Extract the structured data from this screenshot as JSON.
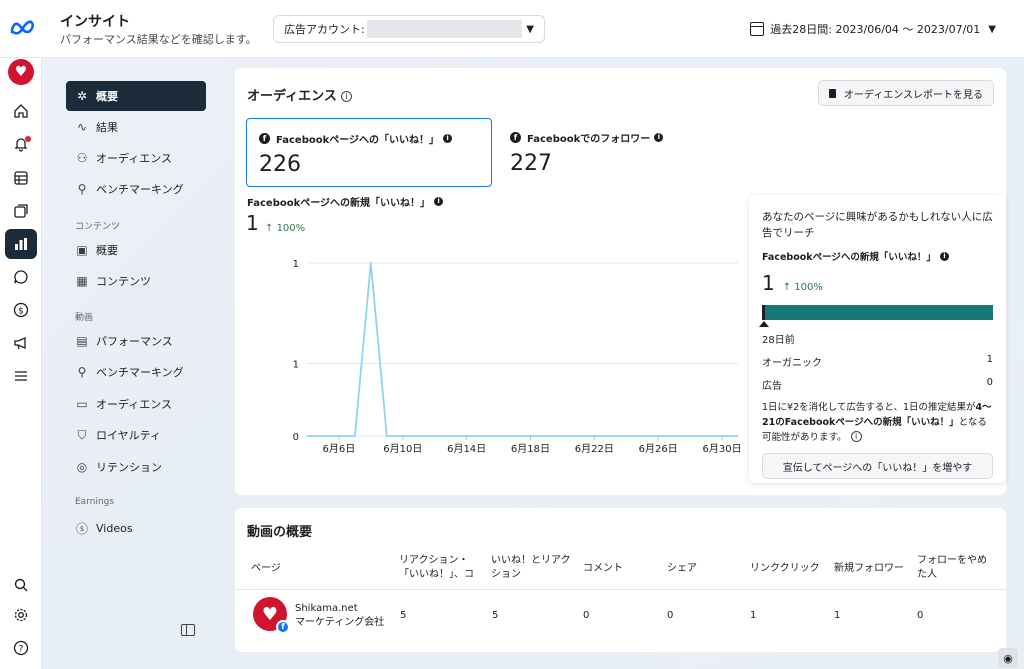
{
  "header": {
    "title": "インサイト",
    "subtitle": "パフォーマンス結果などを確認します。",
    "ad_account_label": "広告アカウント:",
    "date_range": "過去28日間: 2023/06/04 〜 2023/07/01"
  },
  "sidebar": {
    "items": [
      {
        "label": "概要",
        "icon": "overview-icon"
      },
      {
        "label": "結果",
        "icon": "results-icon"
      },
      {
        "label": "オーディエンス",
        "icon": "audience-icon"
      },
      {
        "label": "ベンチマーキング",
        "icon": "benchmark-icon"
      }
    ],
    "content_section": "コンテンツ",
    "content_items": [
      {
        "label": "概要",
        "icon": "content-overview-icon"
      },
      {
        "label": "コンテンツ",
        "icon": "content-table-icon"
      }
    ],
    "video_section": "動画",
    "video_items": [
      {
        "label": "パフォーマンス",
        "icon": "performance-icon"
      },
      {
        "label": "ベンチマーキング",
        "icon": "benchmark-icon"
      },
      {
        "label": "オーディエンス",
        "icon": "video-audience-icon"
      },
      {
        "label": "ロイヤルティ",
        "icon": "loyalty-icon"
      },
      {
        "label": "リテンション",
        "icon": "retention-icon"
      }
    ],
    "earnings_section": "Earnings",
    "earnings_items": [
      {
        "label": "Videos",
        "icon": "dollar-icon"
      }
    ]
  },
  "audience": {
    "title": "オーディエンス",
    "report_button": "オーディエンスレポートを見る",
    "metrics": [
      {
        "label": "Facebookページへの「いいね！」",
        "value": "226"
      },
      {
        "label": "Facebookでのフォロワー",
        "value": "227"
      }
    ],
    "chart_title": "Facebookページへの新規「いいね！」",
    "chart_value": "1",
    "chart_delta": "100%"
  },
  "chart_data": {
    "type": "line",
    "title": "Facebookページへの新規「いいね！」",
    "x": [
      "6/4",
      "6/5",
      "6/6",
      "6/7",
      "6/8",
      "6/9",
      "6/10",
      "6/11",
      "6/12",
      "6/13",
      "6/14",
      "6/15",
      "6/16",
      "6/17",
      "6/18",
      "6/19",
      "6/20",
      "6/21",
      "6/22",
      "6/23",
      "6/24",
      "6/25",
      "6/26",
      "6/27",
      "6/28",
      "6/29",
      "6/30",
      "7/1"
    ],
    "values": [
      0,
      0,
      0,
      0,
      1,
      0,
      0,
      0,
      0,
      0,
      0,
      0,
      0,
      0,
      0,
      0,
      0,
      0,
      0,
      0,
      0,
      0,
      0,
      0,
      0,
      0,
      0,
      0
    ],
    "xtick_labels": [
      "6月6日",
      "6月10日",
      "6月14日",
      "6月18日",
      "6月22日",
      "6月26日",
      "6月30日"
    ],
    "ytick_labels": [
      "1",
      "1",
      "0"
    ],
    "ylim": [
      0,
      1
    ],
    "color": "#8fd3ef",
    "grid": true
  },
  "reach": {
    "heading": "あなたのページに興味があるかもしれない人に広告でリーチ",
    "metric_label": "Facebookページへの新規「いいね！」",
    "value": "1",
    "delta": "100%",
    "days_ago": "28日前",
    "organic_label": "オーガニック",
    "organic_value": "1",
    "ad_label": "広告",
    "ad_value": "0",
    "note_a": "1日に¥2を消化して広告すると、1日の推定結果が",
    "note_b": "4〜21のFacebookページへの新規「いいね！」",
    "note_c": "となる可能性があります。",
    "button": "宣伝してページへの「いいね！」を増やす",
    "bar_color": "#157a74"
  },
  "video_overview": {
    "title": "動画の概要",
    "headers": [
      "ページ",
      "リアクション・「いいね！」、コメ…",
      "いいね！とリアクション",
      "コメント",
      "シェア",
      "リンククリック",
      "新規フォロワー",
      "フォローをやめた人"
    ],
    "row": {
      "page_name": "Shikama.net",
      "page_sub": "マーケティング会社",
      "values": [
        "5",
        "5",
        "0",
        "0",
        "1",
        "1",
        "0"
      ]
    }
  }
}
